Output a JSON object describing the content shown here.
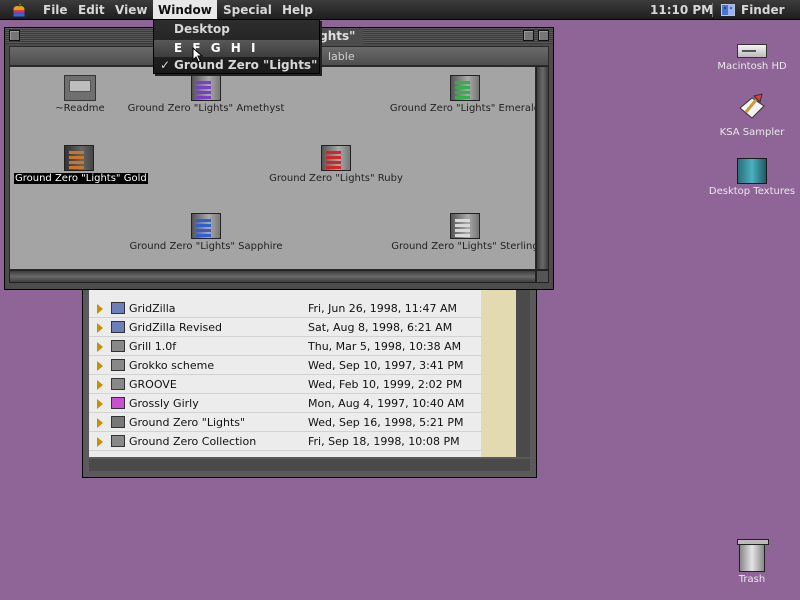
{
  "menubar": {
    "items": [
      "File",
      "Edit",
      "View",
      "Window",
      "Special",
      "Help"
    ],
    "active": "Window",
    "clock": "11:10 PM",
    "app": "Finder"
  },
  "window_menu": {
    "items": [
      "Desktop",
      "E F G H I",
      "Ground Zero \"Lights\""
    ],
    "checked_item": "Ground Zero \"Lights\""
  },
  "front_window": {
    "title": "Ground Zero \"Lights\"",
    "title_visible": "ights\"",
    "info_fragment": "lable",
    "items": [
      {
        "label": "~Readme",
        "kind": "document"
      },
      {
        "label": "Ground Zero \"Lights\" Amethyst",
        "kind": "theme",
        "color": "#7a3fc8"
      },
      {
        "label": "Ground Zero \"Lights\" Emerald",
        "kind": "theme",
        "color": "#2fb24a"
      },
      {
        "label": "Ground Zero \"Lights\" Gold",
        "kind": "theme",
        "color": "#c8772a",
        "selected": true
      },
      {
        "label": "Ground Zero \"Lights\" Ruby",
        "kind": "theme",
        "color": "#d42626"
      },
      {
        "label": "Ground Zero \"Lights\" Sapphire",
        "kind": "theme",
        "color": "#2f5fd6"
      },
      {
        "label": "Ground Zero \"Lights\" Sterling",
        "kind": "theme",
        "color": "#d8d8d8"
      }
    ]
  },
  "list_window": {
    "rows": [
      {
        "name": "GridZilla",
        "date": "Fri, Jun 26, 1998, 11:47 AM",
        "icon_color": "#6c7fb8"
      },
      {
        "name": "GridZilla Revised",
        "date": "Sat, Aug 8, 1998, 6:21 AM",
        "icon_color": "#6c7fb8"
      },
      {
        "name": "Grill 1.0f",
        "date": "Thu, Mar 5, 1998, 10:38 AM",
        "icon_color": "#888888"
      },
      {
        "name": "Grokko scheme",
        "date": "Wed, Sep 10, 1997, 3:41 PM",
        "icon_color": "#888888"
      },
      {
        "name": "GROOVE",
        "date": "Wed, Feb 10, 1999, 2:02 PM",
        "icon_color": "#888888"
      },
      {
        "name": "Grossly Girly",
        "date": "Mon, Aug 4, 1997, 10:40 AM",
        "icon_color": "#c84fd0"
      },
      {
        "name": "Ground Zero  \"Lights\"",
        "date": "Wed, Sep 16, 1998, 5:21 PM",
        "icon_color": "#777777"
      },
      {
        "name": "Ground Zero Collection",
        "date": "Fri, Sep 18, 1998, 10:08 PM",
        "icon_color": "#888888"
      }
    ]
  },
  "desktop_icons": [
    {
      "label": "Macintosh HD",
      "icon": "hard-drive-icon"
    },
    {
      "label": "KSA Sampler",
      "icon": "paint-tool-icon"
    },
    {
      "label": "Desktop Textures",
      "icon": "folder-icon"
    },
    {
      "label": "Trash",
      "icon": "trash-icon"
    }
  ]
}
